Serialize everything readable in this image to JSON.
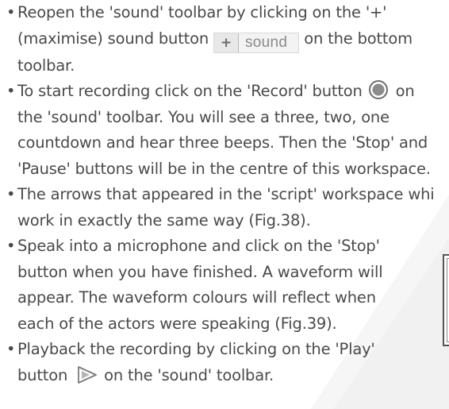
{
  "bullet": "•",
  "items": [
    {
      "line1_pre": "Reopen the 'sound' toolbar by clicking on the '+'",
      "line2_pre": "(maximise) sound button",
      "button_plus": "+",
      "button_label": "sound",
      "line2_post": "on the bottom",
      "line3": "toolbar."
    },
    {
      "line1_pre": "To start recording click on the 'Record' button",
      "line1_post": "on",
      "line2": "the 'sound' toolbar. You will see a three, two, one",
      "line3": "countdown and hear three beeps. Then the 'Stop' and",
      "line4": "'Pause' buttons will be in the centre of this workspace."
    },
    {
      "line1": "The arrows that appeared in the 'script' workspace whi",
      "line2": "work in exactly the same way (Fig.38)."
    },
    {
      "line1": "Speak into a microphone and click on the 'Stop'",
      "line2": "button when you have finished. A waveform will",
      "line3": "appear. The waveform colours will reflect when",
      "line4": "each of the actors were speaking (Fig.39)."
    },
    {
      "line1": "Playback the recording by clicking on the 'Play'",
      "line2_pre": "button",
      "line2_post": "on the 'sound' toolbar."
    }
  ],
  "icons": {
    "record": "record-icon",
    "play": "play-icon",
    "plus": "plus-icon"
  },
  "colors": {
    "text": "#4a4a4a",
    "button_bg": "#f3f3f3",
    "icon_gray": "#8a8a8a"
  }
}
